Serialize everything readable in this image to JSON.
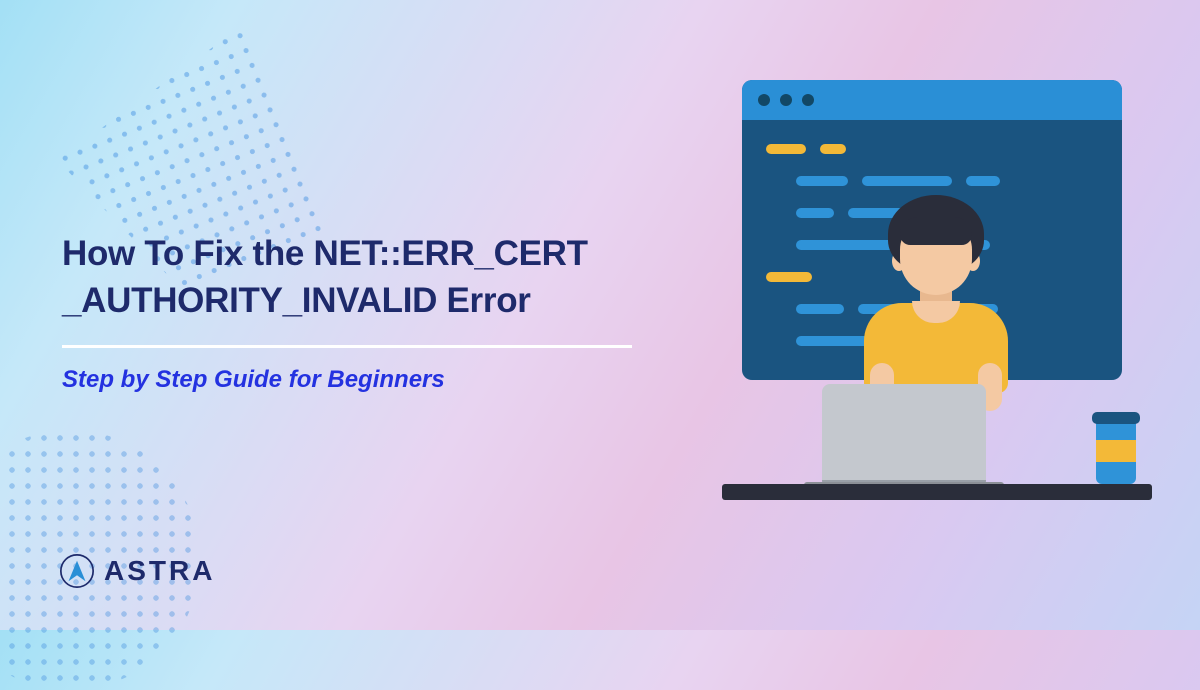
{
  "title_line1": "How To Fix the NET::ERR_CERT",
  "title_line2": "_AUTHORITY_INVALID Error",
  "subtitle": "Step by Step Guide for Beginners",
  "brand": {
    "name": "ASTRA"
  },
  "colors": {
    "heading": "#1e2a6b",
    "subtitle": "#2432e0",
    "accent_yellow": "#f3b938",
    "accent_blue": "#2f93d8",
    "window_dark": "#1a5480"
  }
}
